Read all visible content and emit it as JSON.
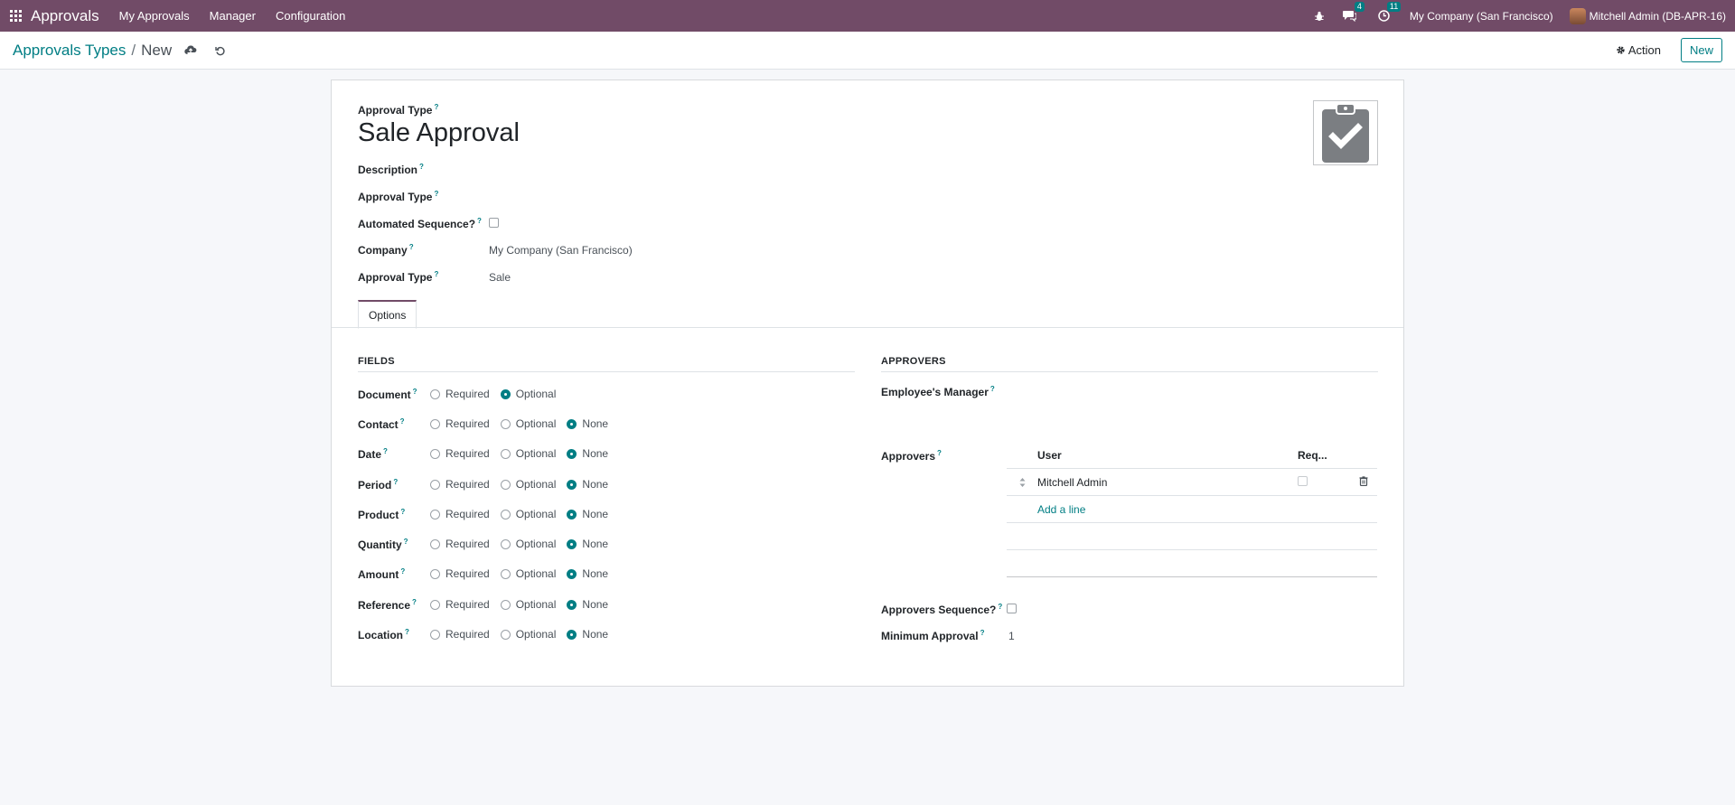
{
  "navbar": {
    "brand": "Approvals",
    "menu": [
      "My Approvals",
      "Manager",
      "Configuration"
    ],
    "messages_count": "4",
    "activities_count": "11",
    "company": "My Company (San Francisco)",
    "user": "Mitchell Admin (DB-APR-16)"
  },
  "control": {
    "breadcrumb_parent": "Approvals Types",
    "breadcrumb_sep": "/",
    "breadcrumb_current": "New",
    "action_label": "Action",
    "new_label": "New"
  },
  "form": {
    "approval_type_label": "Approval Type",
    "title": "Sale Approval",
    "fields": [
      {
        "label": "Description",
        "value": ""
      },
      {
        "label": "Approval Type",
        "value": ""
      },
      {
        "label": "Automated Sequence?",
        "value": ""
      },
      {
        "label": "Company",
        "value": "My Company (San Francisco)"
      },
      {
        "label": "Approval Type",
        "value": "Sale"
      }
    ],
    "tab_label": "Options"
  },
  "fields_section": {
    "title": "FIELDS",
    "options": {
      "required": "Required",
      "optional": "Optional",
      "none": "None"
    },
    "rows": [
      {
        "label": "Document",
        "selected": "optional",
        "has_none": false
      },
      {
        "label": "Contact",
        "selected": "none",
        "has_none": true
      },
      {
        "label": "Date",
        "selected": "none",
        "has_none": true
      },
      {
        "label": "Period",
        "selected": "none",
        "has_none": true
      },
      {
        "label": "Product",
        "selected": "none",
        "has_none": true
      },
      {
        "label": "Quantity",
        "selected": "none",
        "has_none": true
      },
      {
        "label": "Amount",
        "selected": "none",
        "has_none": true
      },
      {
        "label": "Reference",
        "selected": "none",
        "has_none": true
      },
      {
        "label": "Location",
        "selected": "none",
        "has_none": true
      }
    ]
  },
  "approvers_section": {
    "title": "APPROVERS",
    "manager_label": "Employee's Manager",
    "approvers_label": "Approvers",
    "col_user": "User",
    "col_required": "Req...",
    "rows": [
      {
        "user": "Mitchell Admin"
      }
    ],
    "add_line": "Add a line",
    "sequence_label": "Approvers Sequence?",
    "minimum_label": "Minimum Approval",
    "minimum_value": "1"
  },
  "colors": {
    "brand": "#714b67",
    "accent": "#017e84"
  }
}
